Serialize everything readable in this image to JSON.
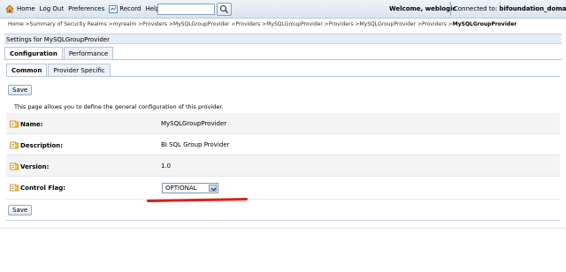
{
  "topbar": {
    "nav": [
      "Home",
      "Log Out",
      "Preferences",
      "Record",
      "Help"
    ],
    "welcome": "Welcome, weblogic",
    "connected_label": "Connected to:",
    "connected_domain": "bifoundation_domain"
  },
  "breadcrumb": {
    "path": "Home >Summary of Security Realms >myrealm >Providers >MySQLGroupProvider >Providers >MySQLGroupProvider >Providers >MySQLGroupProvider >Providers >",
    "current": "MySQLGroupProvider"
  },
  "settings_title": "Settings for MySQLGroupProvider",
  "tabs": [
    "Configuration",
    "Performance"
  ],
  "subtabs": [
    "Common",
    "Provider Specific"
  ],
  "save_label": "Save",
  "intro": "This page allows you to define the general configuration of this provider.",
  "fields": [
    {
      "label": "Name:",
      "value": "MySQLGroupProvider"
    },
    {
      "label": "Description:",
      "value": "BI SQL Group Provider"
    },
    {
      "label": "Version:",
      "value": "1.0"
    },
    {
      "label": "Control Flag:",
      "value": "OPTIONAL"
    }
  ],
  "icons": {
    "home": "home-icon",
    "record": "record-icon",
    "search": "search-icon",
    "field": "field-info-icon"
  },
  "colors": {
    "annotation": "#d9211b",
    "header_bg": "#e7edf5"
  }
}
